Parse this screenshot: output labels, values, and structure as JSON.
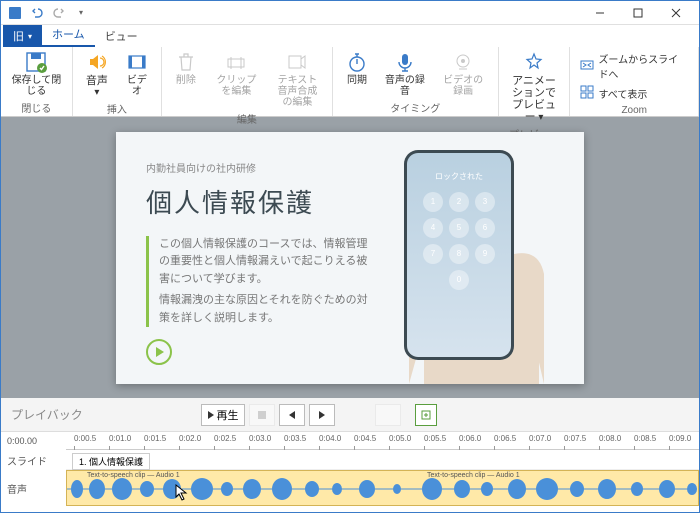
{
  "qat": {
    "tip": "▾"
  },
  "tabs": {
    "file": "旧",
    "home": "ホーム",
    "view": "ビュー"
  },
  "ribbon": {
    "close": {
      "label": "保存して閉じる",
      "group": "閉じる"
    },
    "insert": {
      "audio": "音声",
      "video": "ビデオ",
      "group": "挿入"
    },
    "edit": {
      "delete": "削除",
      "editClip": "クリップを編集",
      "tts": "テキスト音声合成の編集",
      "group": "編集"
    },
    "timing": {
      "sync": "同期",
      "record": "音声の録音",
      "videoRec": "ビデオの録画",
      "group": "タイミング"
    },
    "preview": {
      "anim": "アニメーションでプレビュー",
      "group": "プレビュー"
    },
    "zoom": {
      "fit": "ズームからスライドへ",
      "all": "すべて表示",
      "group": "Zoom"
    }
  },
  "slide": {
    "eyebrow": "内勤社員向けの社内研修",
    "title": "個人情報保護",
    "body1": "この個人情報保護のコースでは、情報管理の重要性と個人情報漏えいで起こりえる被害について学びます。",
    "body2": "情報漏洩の主な原因とそれを防ぐための対策を詳しく説明します。",
    "phoneLock": "ロックされた"
  },
  "playback": {
    "label": "プレイバック",
    "play": "再生"
  },
  "timeline": {
    "start": "0:00.00",
    "slideLabel": "スライド",
    "audioLabel": "音声",
    "slideChip": "1. 個人情報保護",
    "clip1": "Text-to-speech clip — Audio 1",
    "clip2": "Text-to-speech clip — Audio 1",
    "ticks": [
      "0:00.5",
      "0:01.0",
      "0:01.5",
      "0:02.0",
      "0:02.5",
      "0:03.0",
      "0:03.5",
      "0:04.0",
      "0:04.5",
      "0:05.0",
      "0:05.5",
      "0:06.0",
      "0:06.5",
      "0:07.0",
      "0:07.5",
      "0:08.0",
      "0:08.5",
      "0:09.0"
    ]
  },
  "keys": [
    "1",
    "2",
    "3",
    "4",
    "5",
    "6",
    "7",
    "8",
    "9",
    "",
    "0",
    ""
  ]
}
